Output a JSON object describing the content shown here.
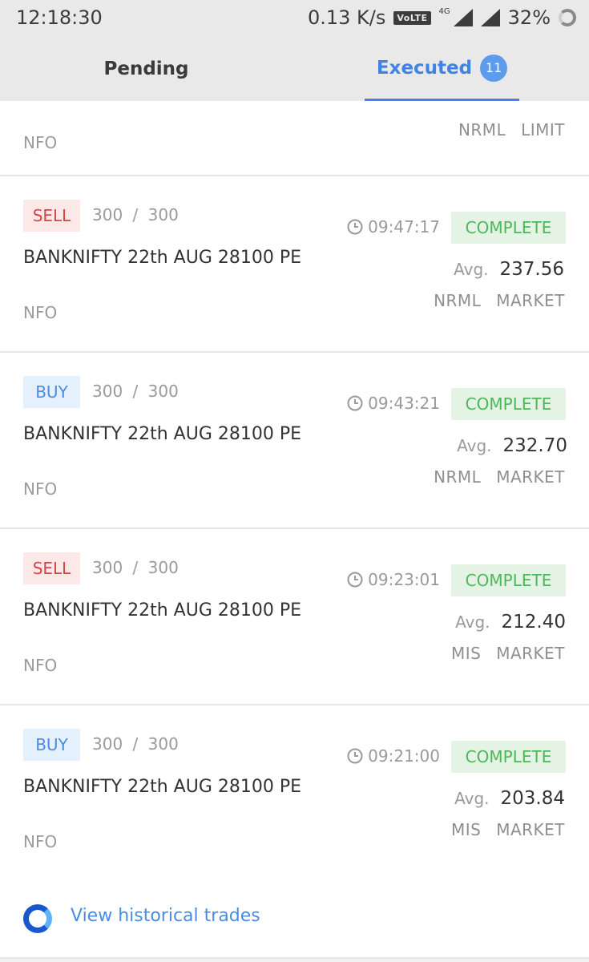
{
  "status_bar": {
    "time": "12:18:30",
    "speed": "0.13 K/s",
    "volte": "VoLTE",
    "network": "4G",
    "battery": "32%"
  },
  "tabs": {
    "pending": "Pending",
    "executed": "Executed",
    "executed_count": "11"
  },
  "partial_order": {
    "exchange": "NFO",
    "product": "NRML",
    "order_type": "LIMIT"
  },
  "orders": [
    {
      "side": "SELL",
      "qty": "300 / 300",
      "time": "09:47:17",
      "status": "COMPLETE",
      "instrument": "BANKNIFTY 22th  AUG 28100 PE",
      "avg_label": "Avg.",
      "avg": "237.56",
      "exchange": "NFO",
      "product": "NRML",
      "order_type": "MARKET"
    },
    {
      "side": "BUY",
      "qty": "300 / 300",
      "time": "09:43:21",
      "status": "COMPLETE",
      "instrument": "BANKNIFTY 22th  AUG 28100 PE",
      "avg_label": "Avg.",
      "avg": "232.70",
      "exchange": "NFO",
      "product": "NRML",
      "order_type": "MARKET"
    },
    {
      "side": "SELL",
      "qty": "300 / 300",
      "time": "09:23:01",
      "status": "COMPLETE",
      "instrument": "BANKNIFTY 22th  AUG 28100 PE",
      "avg_label": "Avg.",
      "avg": "212.40",
      "exchange": "NFO",
      "product": "MIS",
      "order_type": "MARKET"
    },
    {
      "side": "BUY",
      "qty": "300 / 300",
      "time": "09:21:00",
      "status": "COMPLETE",
      "instrument": "BANKNIFTY 22th  AUG 28100 PE",
      "avg_label": "Avg.",
      "avg": "203.84",
      "exchange": "NFO",
      "product": "MIS",
      "order_type": "MARKET"
    }
  ],
  "history": {
    "label": "View historical trades"
  },
  "colors": {
    "accent": "#3f84e5",
    "sell": "#d54545",
    "buy": "#4a8ce4",
    "complete": "#4db75a"
  }
}
